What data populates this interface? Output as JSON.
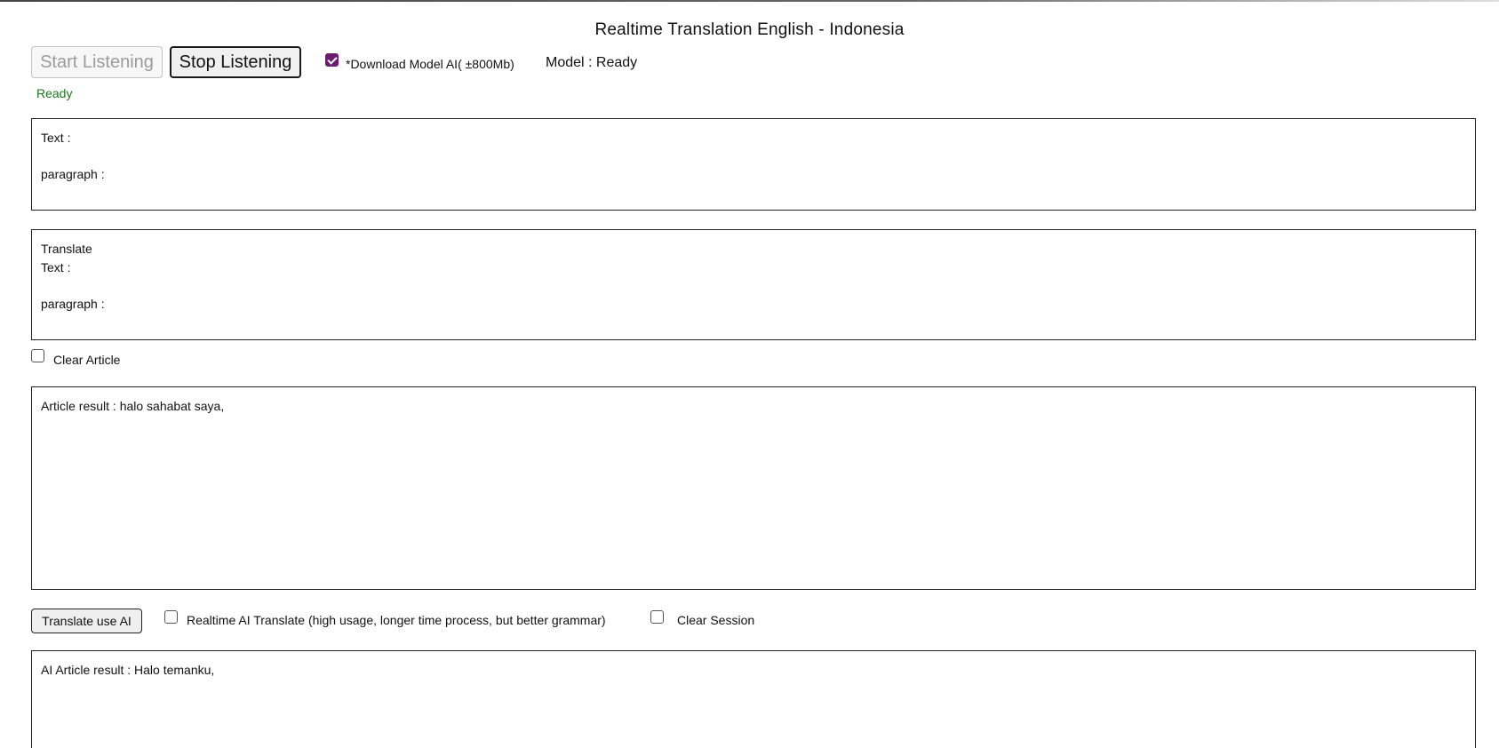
{
  "page": {
    "title": "Realtime Translation English - Indonesia"
  },
  "controls": {
    "start_label": "Start Listening",
    "stop_label": "Stop Listening",
    "download_model_label": "*Download Model AI( ±800Mb)",
    "download_model_checked": true,
    "model_status": "Model : Ready",
    "listen_status": "Ready",
    "status_color": "#1a7a1a",
    "checkbox_accent": "#6b1d6f"
  },
  "text_box": {
    "text_label": "Text :",
    "paragraph_label": "paragraph :"
  },
  "translate_box": {
    "heading": "Translate",
    "text_label": "Text :",
    "paragraph_label": "paragraph :"
  },
  "clear_article": {
    "label": "Clear Article",
    "checked": false
  },
  "article": {
    "result": "Article result : halo sahabat saya,"
  },
  "ai_controls": {
    "translate_button_label": "Translate use AI",
    "realtime_label": "Realtime AI Translate (high usage, longer time process, but better grammar)",
    "realtime_checked": false,
    "clear_session_label": "Clear Session",
    "clear_session_checked": false
  },
  "ai_article": {
    "result": "AI Article result : Halo temanku,"
  }
}
